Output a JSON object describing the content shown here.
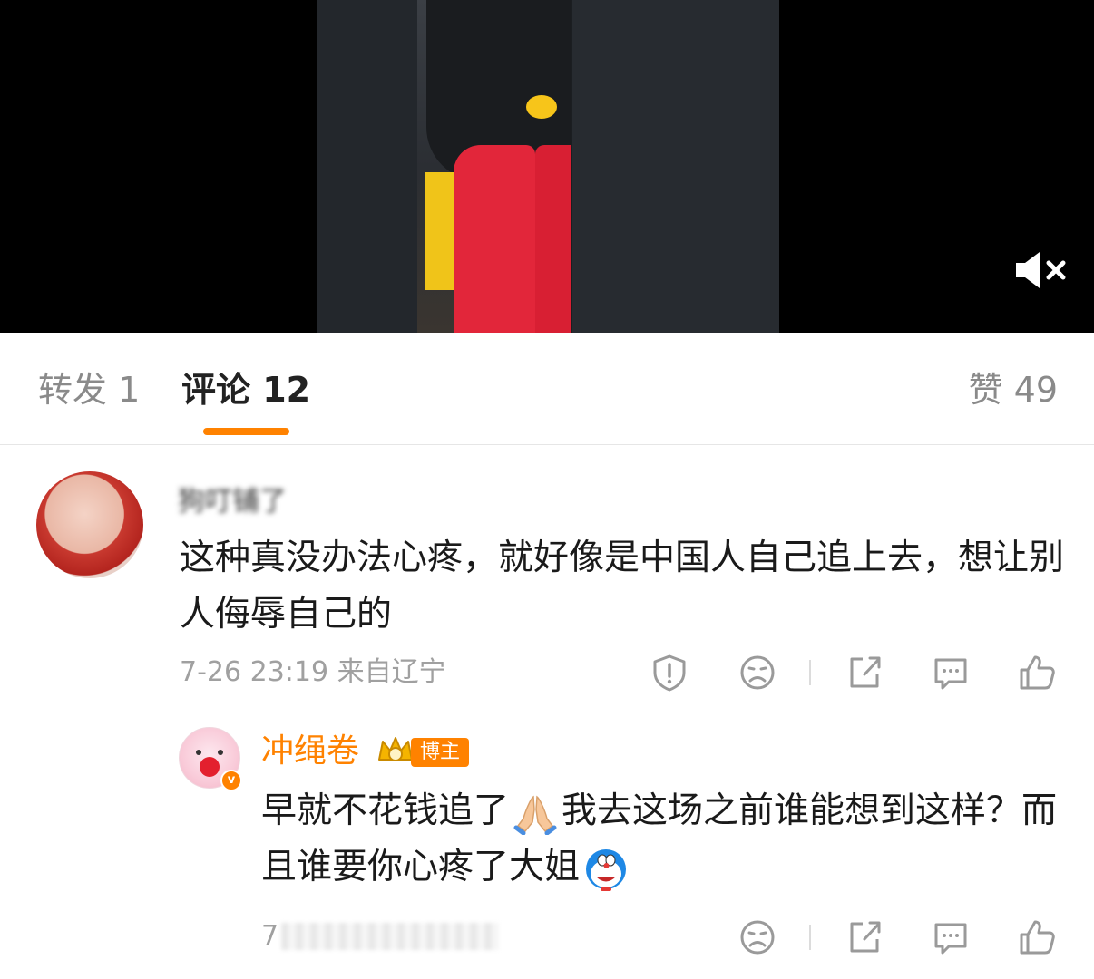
{
  "tabs": {
    "repost": "转发 1",
    "comment": "评论 12",
    "like": "赞 49"
  },
  "comments": [
    {
      "username": "狗叮铺了",
      "content": "这种真没办法心疼，就好像是中国人自己追上去，想让别人侮辱自己的",
      "time": "7-26 23:19",
      "location": "来自辽宁"
    },
    {
      "username": "冲绳卷",
      "badge": "博主",
      "content_part1": "早就不花钱追了",
      "content_part2": "我去这场之前谁能想到这样？而且谁要你心疼了大姐",
      "time": "7"
    }
  ],
  "icons": {
    "mute": "speaker-mute-icon",
    "report": "report-icon",
    "dislike": "sad-face-icon",
    "share": "share-icon",
    "reply": "comment-icon",
    "like": "thumbs-up-icon"
  },
  "colors": {
    "accent": "#ff8200",
    "muted_text": "#a0a0a0"
  }
}
